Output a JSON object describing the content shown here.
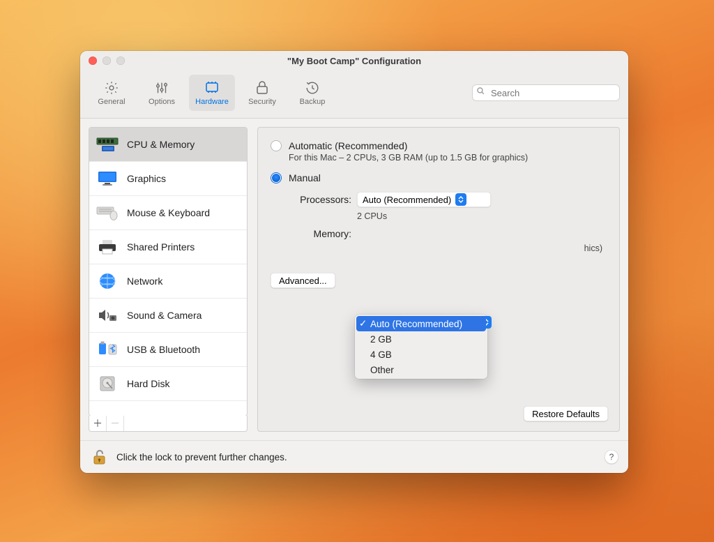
{
  "window": {
    "title": "\"My Boot Camp\" Configuration"
  },
  "toolbar": {
    "items": [
      {
        "label": "General"
      },
      {
        "label": "Options"
      },
      {
        "label": "Hardware"
      },
      {
        "label": "Security"
      },
      {
        "label": "Backup"
      }
    ],
    "search_placeholder": "Search"
  },
  "sidebar": {
    "items": [
      {
        "label": "CPU & Memory"
      },
      {
        "label": "Graphics"
      },
      {
        "label": "Mouse & Keyboard"
      },
      {
        "label": "Shared Printers"
      },
      {
        "label": "Network"
      },
      {
        "label": "Sound & Camera"
      },
      {
        "label": "USB & Bluetooth"
      },
      {
        "label": "Hard Disk"
      }
    ]
  },
  "panel": {
    "automatic_label": "Automatic (Recommended)",
    "automatic_sub": "For this Mac – 2 CPUs, 3 GB RAM (up to 1.5 GB for graphics)",
    "manual_label": "Manual",
    "processors_label": "Processors:",
    "processors_value": "Auto (Recommended)",
    "processors_hint": "2 CPUs",
    "memory_label": "Memory:",
    "memory_hint_tail": "hics)",
    "advanced_label": "Advanced...",
    "restore_label": "Restore Defaults"
  },
  "memory_menu": {
    "options": [
      {
        "label": "Auto (Recommended)"
      },
      {
        "label": "2 GB"
      },
      {
        "label": "4 GB"
      },
      {
        "label": "Other"
      }
    ]
  },
  "footer": {
    "lock_text": "Click the lock to prevent further changes.",
    "help": "?"
  }
}
